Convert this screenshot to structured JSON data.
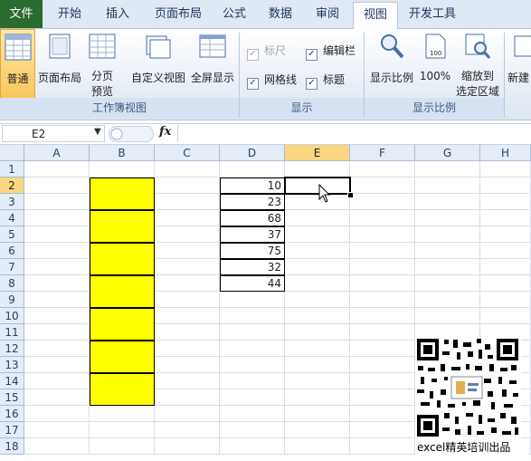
{
  "tabs": [
    "文件",
    "开始",
    "插入",
    "页面布局",
    "公式",
    "数据",
    "审阅",
    "视图",
    "开发工具"
  ],
  "active_tab": "视图",
  "ribbon": {
    "workbook_views": {
      "normal": "普通",
      "page_layout": "页面布局",
      "page_break_1": "分页",
      "page_break_2": "预览",
      "custom_view": "自定义视图",
      "full_screen": "全屏显示",
      "label": "工作簿视图"
    },
    "show": {
      "ruler": "标尺",
      "formula_bar": "编辑栏",
      "gridlines": "网格线",
      "headings": "标题",
      "label": "显示"
    },
    "zoom": {
      "zoom": "显示比例",
      "hundred": "100%",
      "zoom_sel_1": "缩放到",
      "zoom_sel_2": "选定区域",
      "label": "显示比例"
    },
    "new_window": "新建"
  },
  "formula_bar": {
    "name_box": "E2",
    "fx": "fx",
    "content": ""
  },
  "columns": [
    "A",
    "B",
    "C",
    "D",
    "E",
    "F",
    "G",
    "H"
  ],
  "rows": [
    "1",
    "2",
    "3",
    "4",
    "5",
    "6",
    "7",
    "8",
    "9",
    "10",
    "11",
    "12",
    "13",
    "14",
    "15",
    "16",
    "17",
    "18"
  ],
  "d_values": [
    "10",
    "23",
    "68",
    "37",
    "75",
    "32",
    "44"
  ],
  "selected_cell": "E2",
  "highlight_color": "#ffff00",
  "watermark": "excel精英培训出品"
}
